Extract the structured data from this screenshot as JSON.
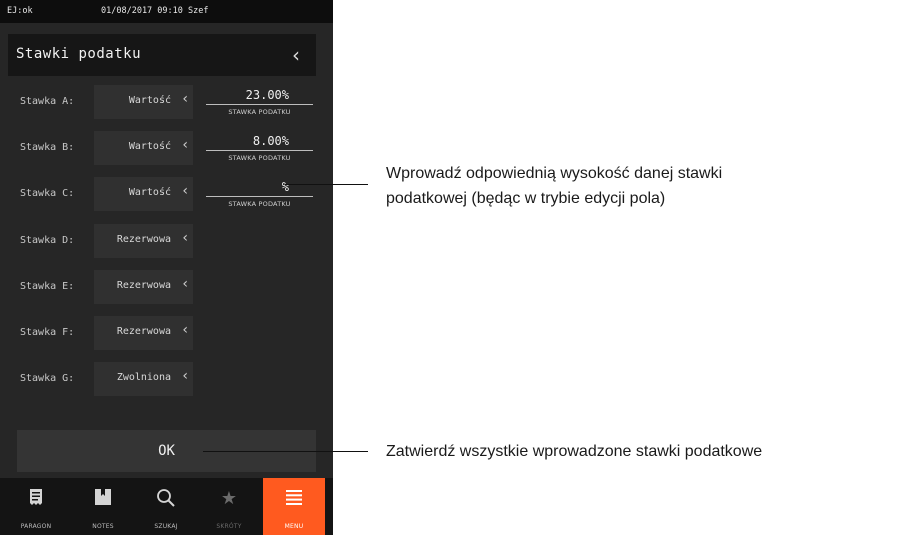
{
  "statusbar": {
    "left": "EJ:ok",
    "center": "01/08/2017 09:10 Szef"
  },
  "header": {
    "title": "Stawki podatku",
    "back_icon": "chevron-left-icon"
  },
  "rows": [
    {
      "label": "Stawka A:",
      "value": "Wartość"
    },
    {
      "label": "Stawka B:",
      "value": "Wartość"
    },
    {
      "label": "Stawka C:",
      "value": "Wartość"
    },
    {
      "label": "Stawka D:",
      "value": "Rezerwowa"
    },
    {
      "label": "Stawka E:",
      "value": "Rezerwowa"
    },
    {
      "label": "Stawka F:",
      "value": "Rezerwowa"
    },
    {
      "label": "Stawka G:",
      "value": "Zwolniona"
    }
  ],
  "fields": [
    {
      "value": "23.00%",
      "caption": "STAWKA PODATKU"
    },
    {
      "value": "8.00%",
      "caption": "STAWKA PODATKU"
    },
    {
      "value": "%",
      "caption": "STAWKA PODATKU"
    }
  ],
  "ok_label": "OK",
  "nav": [
    {
      "label": "PARAGON",
      "icon": "receipt-icon"
    },
    {
      "label": "NOTES",
      "icon": "bookmark-icon"
    },
    {
      "label": "SZUKAJ",
      "icon": "search-icon"
    },
    {
      "label": "SKRÓTY",
      "icon": "star-icon"
    },
    {
      "label": "MENU",
      "icon": "menu-icon"
    }
  ],
  "annotations": {
    "field_line1": "Wprowadź odpowiednią wysokość danej stawki",
    "field_line2": "podatkowej (będąc w trybie edycji pola)",
    "ok": "Zatwierdź wszystkie wprowadzone stawki podatkowe"
  },
  "colors": {
    "accent": "#ff5a1f",
    "background": "#262626"
  }
}
